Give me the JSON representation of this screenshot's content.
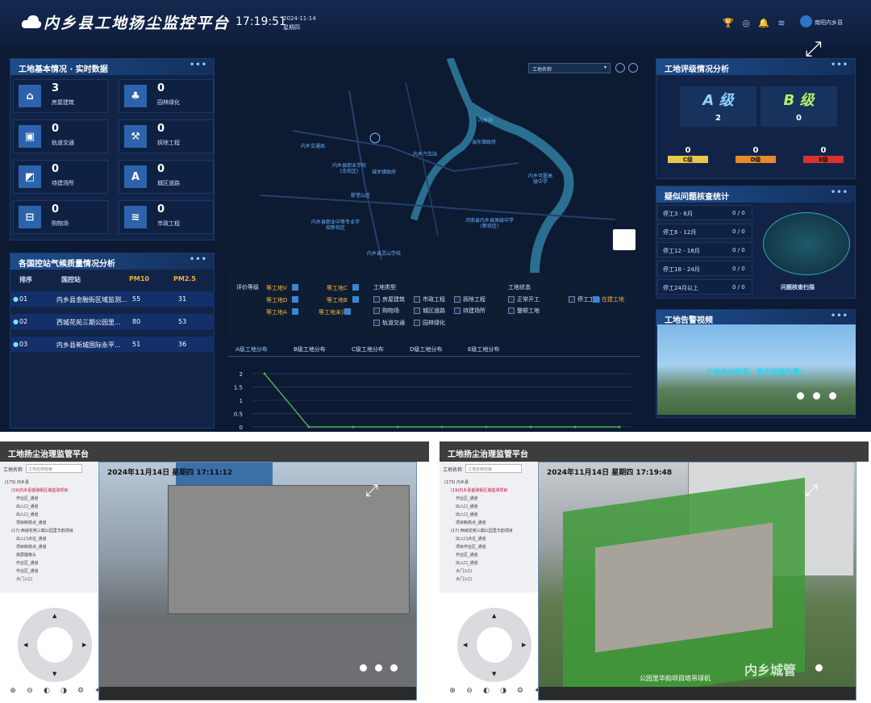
{
  "header": {
    "title": "内乡县工地扬尘监控平台",
    "time": "17:19:51",
    "date": "2024-11-14",
    "weekday": "星期四",
    "user": "南阳内乡县"
  },
  "site_panel": {
    "title": "工地基本情况 · 实时数据",
    "tiles": [
      {
        "icon": "house-icon",
        "value": "3",
        "label": "房屋建筑"
      },
      {
        "icon": "tree-icon",
        "value": "0",
        "label": "园林绿化"
      },
      {
        "icon": "bus-icon",
        "value": "0",
        "label": "轨道交通"
      },
      {
        "icon": "hammer-icon",
        "value": "0",
        "label": "拆除工程"
      },
      {
        "icon": "bulldozer-icon",
        "value": "0",
        "label": "待建场所"
      },
      {
        "icon": "road-icon",
        "value": "0",
        "label": "城区道路"
      },
      {
        "icon": "market-icon",
        "value": "0",
        "label": "购物场"
      },
      {
        "icon": "layers-icon",
        "value": "0",
        "label": "市政工程"
      }
    ]
  },
  "air_panel": {
    "title": "各国控站气候质量情况分析",
    "headers": [
      "排序",
      "国控站",
      "PM10",
      "PM2.5"
    ],
    "rows": [
      {
        "rank": "01",
        "name": "内乡县金融街区域监测...",
        "pm10": "55",
        "pm25": "31"
      },
      {
        "rank": "02",
        "name": "西城花苑三期公园里...",
        "pm10": "80",
        "pm25": "53"
      },
      {
        "rank": "03",
        "name": "内乡县新城国际永平...",
        "pm10": "51",
        "pm25": "36"
      }
    ]
  },
  "map": {
    "select": "工地名称",
    "labels": [
      "内乡站",
      "湍东镇政府",
      "内乡汽车站",
      "内乡县职业学校(北校区)",
      "城关镇政府",
      "内乡交通局",
      "内乡可厦高级中学",
      "靳堂山庄",
      "内乡县职业中等专业学校新校区",
      "河南省内乡县高级中学(新校区)",
      "内乡县灵山学校"
    ],
    "filter": {
      "rating_label": "评价等级",
      "ratings": [
        "等工地V",
        "等工地C",
        "等工地D",
        "等工地B",
        "等工地A",
        "等工地未评"
      ],
      "type_label": "工地类型",
      "types": [
        "房屋建筑",
        "市政工程",
        "拆除工程",
        "购物场",
        "城区道路",
        "待建场所",
        "轨道交通",
        "园林绿化"
      ],
      "status_label": "工地状态",
      "statuses": [
        "正常开工",
        "整顿工地",
        "停工工地",
        "在建工地"
      ]
    }
  },
  "chart_tabs": [
    "A级工地分布",
    "B级工地分布",
    "C级工地分布",
    "D级工地分布",
    "E级工地分布"
  ],
  "chart_data": {
    "type": "line",
    "y_ticks": [
      "0",
      "0.5",
      "1",
      "1.5",
      "2"
    ],
    "ylim": [
      0,
      2
    ],
    "values": [
      2,
      0,
      0,
      0,
      0,
      0,
      0,
      0,
      0
    ],
    "color": "#4caf50"
  },
  "grade_panel": {
    "title": "工地评级情况分析",
    "grades": [
      {
        "label": "A 级",
        "value": "2"
      },
      {
        "label": "B 级",
        "value": "0"
      }
    ],
    "small": [
      {
        "label": "C级",
        "value": "0",
        "color": "#e8c84a"
      },
      {
        "label": "D级",
        "value": "0",
        "color": "#e88a2a"
      },
      {
        "label": "E级",
        "value": "0",
        "color": "#d8322a"
      }
    ]
  },
  "issue_panel": {
    "title": "疑似问题核查统计",
    "rows": [
      {
        "label": "停工3 - 6月",
        "value": "0 / 0"
      },
      {
        "label": "停工6 - 12月",
        "value": "0 / 0"
      },
      {
        "label": "停工12 - 18月",
        "value": "0 / 0"
      },
      {
        "label": "停工18 - 24月",
        "value": "0 / 0"
      },
      {
        "label": "停工24月以上",
        "value": "0 / 0"
      }
    ],
    "radar_label": "问题核查扫描"
  },
  "video_panel": {
    "title": "工地告警视频",
    "message": "工地作业规范，暂无视频告警！"
  },
  "left_app": {
    "title": "工地扬尘治理监管平台",
    "search_label": "工地名称",
    "search_placeholder": "工地名称检索",
    "tree": [
      {
        "label": "(173) 内乡县",
        "hl": false
      },
      {
        "label": "(19)内乡县金融街区域监测项目",
        "hl": true
      },
      {
        "label": "作业区_通道",
        "hl": false
      },
      {
        "label": "出入口_通道",
        "hl": false
      },
      {
        "label": "出入口_通道",
        "hl": false
      },
      {
        "label": "项目制高点_通道",
        "hl": false
      },
      {
        "label": "(17) 西城花苑三期公园里华韵项目",
        "hl": false
      },
      {
        "label": "出入口点位_通道",
        "hl": false
      },
      {
        "label": "项目制高点_通道",
        "hl": false
      },
      {
        "label": "高层摄像头",
        "hl": false
      },
      {
        "label": "作业区_通道",
        "hl": false
      },
      {
        "label": "作业区_通道",
        "hl": false
      },
      {
        "label": "大门入口",
        "hl": false
      }
    ],
    "cam_time": "2024年11月14日  星期四  17:11:12"
  },
  "right_app": {
    "title": "工地扬尘治理监管平台",
    "search_label": "工地名称",
    "search_placeholder": "工地名称检索",
    "tree": [
      {
        "label": "(173) 内乡县",
        "hl": false
      },
      {
        "label": "(19)内乡县金融街区域监测项目",
        "hl": true
      },
      {
        "label": "作业区_通道",
        "hl": false
      },
      {
        "label": "出入口_通道",
        "hl": false
      },
      {
        "label": "出入口_通道",
        "hl": false
      },
      {
        "label": "项目制高点_通道",
        "hl": false
      },
      {
        "label": "(17) 西城花苑三期公园里华韵项目",
        "hl": false
      },
      {
        "label": "出入口点位_通道",
        "hl": false
      },
      {
        "label": "项目作业区_通道",
        "hl": false
      },
      {
        "label": "作业区_通道",
        "hl": false
      },
      {
        "label": "出入口_通道",
        "hl": false
      },
      {
        "label": "大门入口",
        "hl": false
      },
      {
        "label": "大门入口",
        "hl": false
      }
    ],
    "cam_time": "2024年11月14日  星期四  17:19:48",
    "watermark": "内乡城管",
    "camera_caption": "公园里华韵项目塔吊球机"
  }
}
